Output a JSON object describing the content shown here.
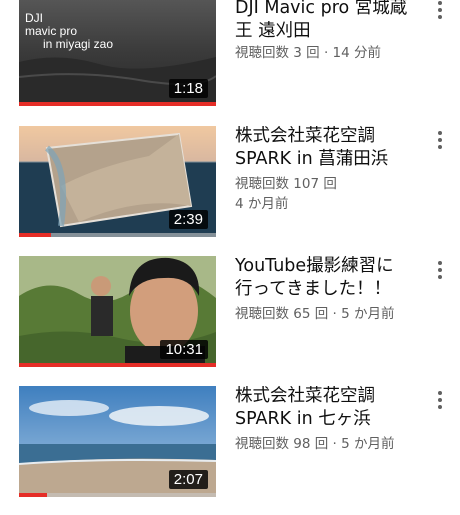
{
  "videos": [
    {
      "title_line1": "DJI Mavic pro 宮城蔵",
      "title_line2": "王 遠刈田",
      "meta_line1": "視聴回数 3 回 · 14 分前",
      "meta_line2": "",
      "duration": "1:18",
      "progress": 1.0,
      "overlay_lines": [
        "DJI",
        "mavic  pro",
        "in  miyagi zao"
      ]
    },
    {
      "title_line1": "株式会社菜花空調",
      "title_line2": "SPARK in 菖蒲田浜",
      "meta_line1": "視聴回数 107 回",
      "meta_line2": "4 か月前",
      "duration": "2:39",
      "progress": 0.16
    },
    {
      "title_line1": "YouTube撮影練習に",
      "title_line2": "行ってきました！！",
      "meta_line1": "視聴回数 65 回 · 5 か月前",
      "meta_line2": "",
      "duration": "10:31",
      "progress": 1.0
    },
    {
      "title_line1": "株式会社菜花空調",
      "title_line2": "SPARK in 七ヶ浜",
      "meta_line1": "視聴回数 98 回 · 5 か月前",
      "meta_line2": "",
      "duration": "2:07",
      "progress": 0.14
    }
  ],
  "colors": {
    "progress": "#e52d27",
    "title": "#0f0f0f",
    "meta": "#606060"
  },
  "icons": {
    "more": "more-vert-icon"
  }
}
